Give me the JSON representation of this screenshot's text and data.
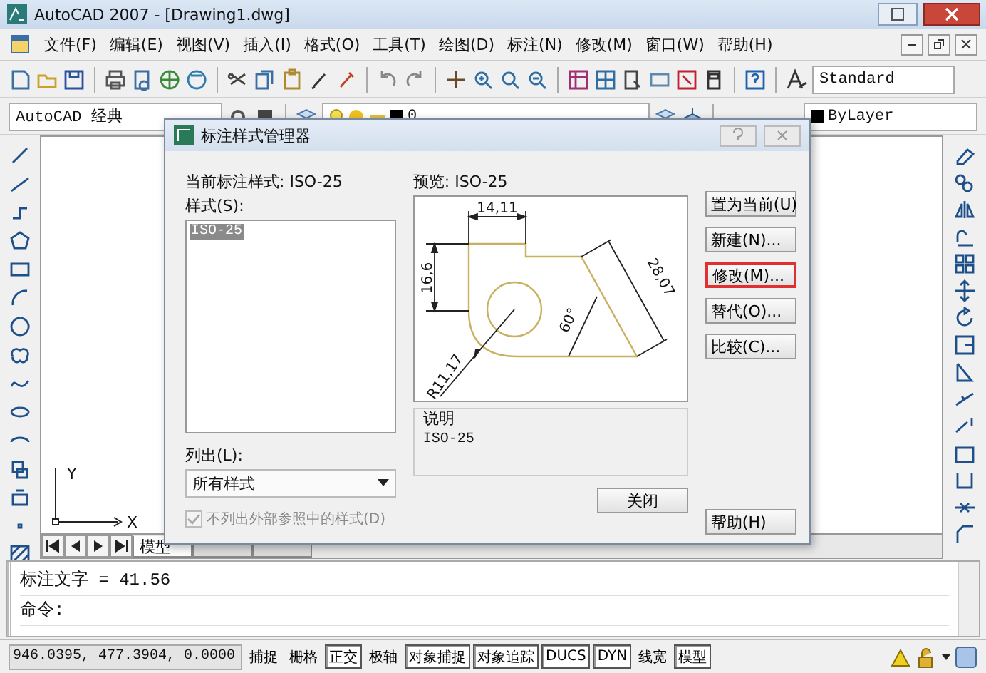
{
  "window": {
    "title": "AutoCAD 2007 - [Drawing1.dwg]"
  },
  "menu": [
    "文件(F)",
    "编辑(E)",
    "视图(V)",
    "插入(I)",
    "格式(O)",
    "工具(T)",
    "绘图(D)",
    "标注(N)",
    "修改(M)",
    "窗口(W)",
    "帮助(H)"
  ],
  "toolbar": {
    "text_style": "Standard",
    "workspace": "AutoCAD 经典",
    "layer": "0",
    "color_control": "ByLayer"
  },
  "canvas": {
    "ucs_y": "Y",
    "ucs_x": "X",
    "tabs": [
      {
        "label": "模型",
        "selected": true
      }
    ]
  },
  "dialog": {
    "title": "标注样式管理器",
    "current_style": "当前标注样式: ISO-25",
    "styles_label": "样式(S):",
    "styles": [
      {
        "label": "ISO-25",
        "selected": true
      }
    ],
    "preview_label": "预览: ISO-25",
    "dims": [
      "14,11",
      "16,6",
      "28,07",
      "60°",
      "R11,17"
    ],
    "list_label": "列出(L):",
    "list_value": "所有样式",
    "xref_checkbox": {
      "label": "不列出外部参照中的样式(D)",
      "checked": true,
      "disabled": true
    },
    "description_label": "说明",
    "description": "ISO-25",
    "side_buttons": [
      {
        "label": "置为当前(U)",
        "highlighted": false
      },
      {
        "label": "新建(N)...",
        "highlighted": false
      },
      {
        "label": "修改(M)...",
        "highlighted": true
      },
      {
        "label": "替代(O)...",
        "highlighted": false
      },
      {
        "label": "比较(C)...",
        "highlighted": false
      }
    ],
    "close": "关闭",
    "help": "帮助(H)"
  },
  "command": [
    "标注文字 = 41.56",
    "命令:"
  ],
  "status_bar": {
    "coords": "946.0395, 477.3904, 0.0000",
    "toggles": [
      {
        "label": "捕捉",
        "on": false
      },
      {
        "label": "栅格",
        "on": false
      },
      {
        "label": "正交",
        "on": true
      },
      {
        "label": "极轴",
        "on": false
      },
      {
        "label": "对象捕捉",
        "on": true
      },
      {
        "label": "对象追踪",
        "on": true
      },
      {
        "label": "DUCS",
        "on": true
      },
      {
        "label": "DYN",
        "on": true
      },
      {
        "label": "线宽",
        "on": false
      },
      {
        "label": "模型",
        "on": true
      }
    ]
  }
}
